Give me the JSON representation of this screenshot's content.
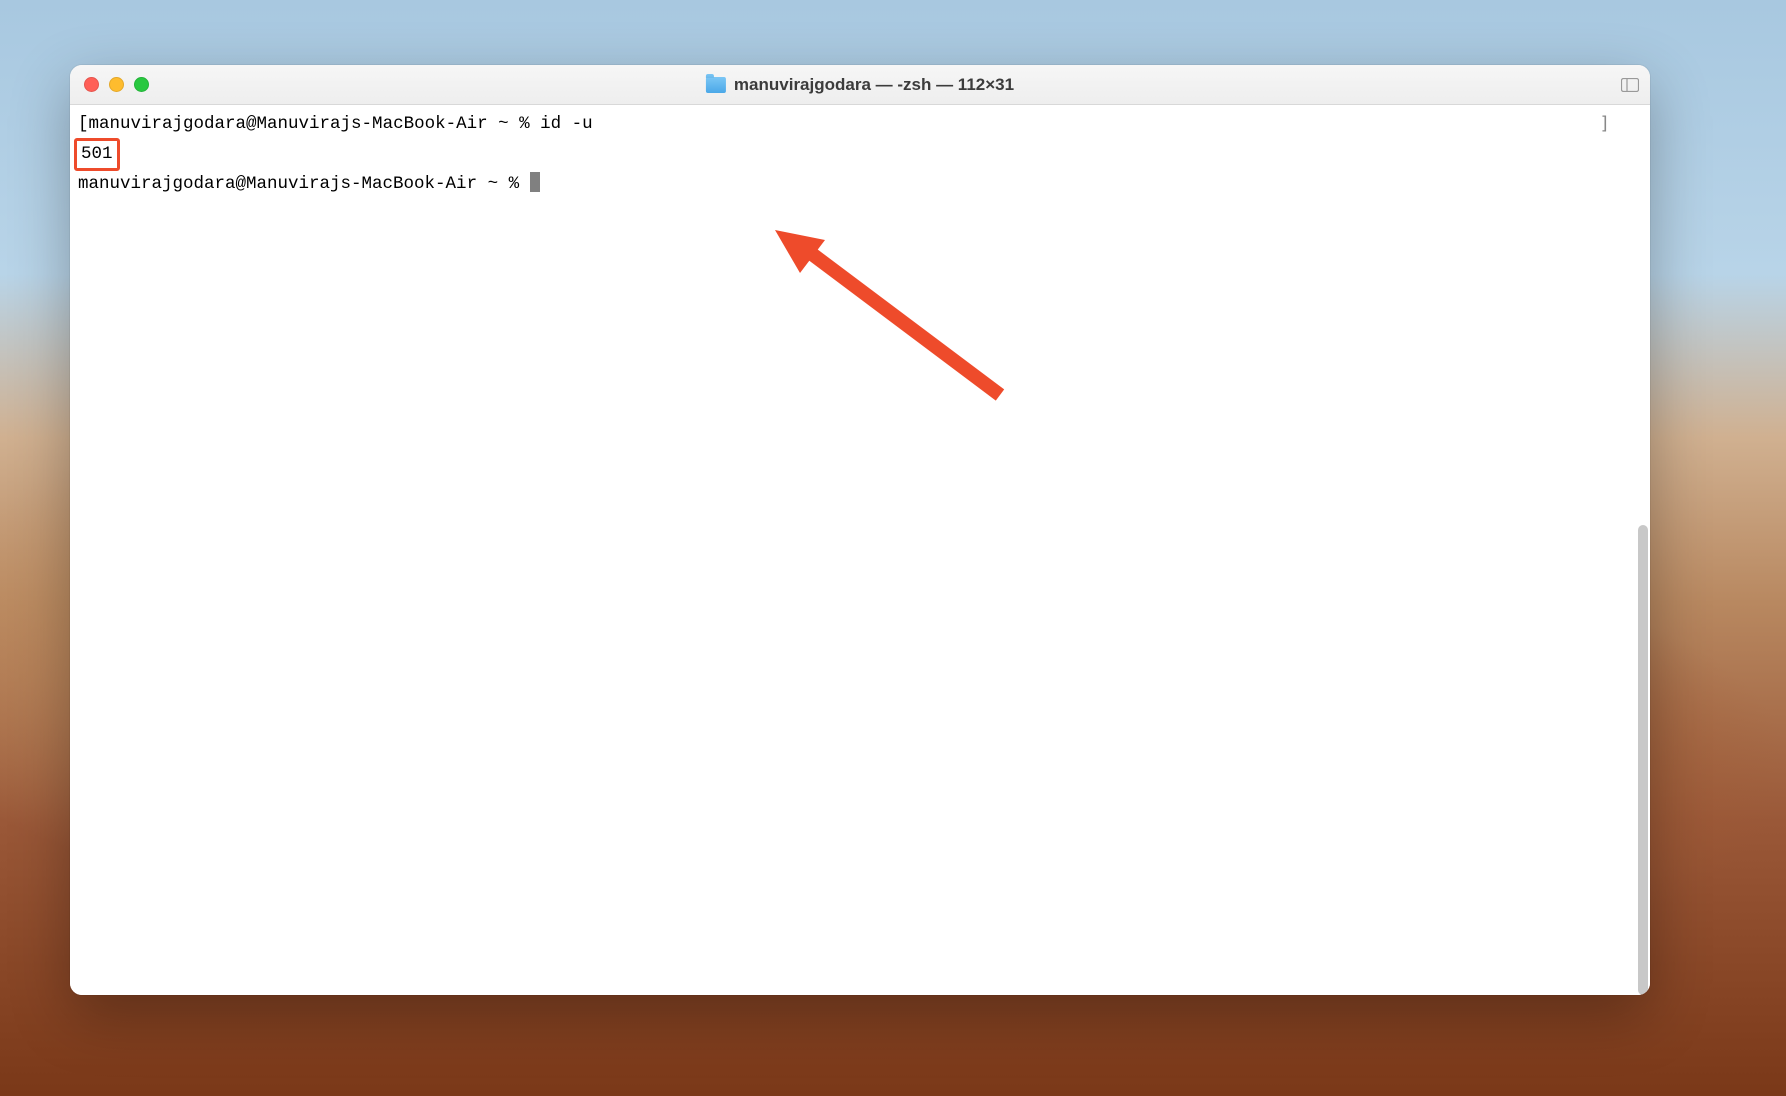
{
  "window": {
    "title": "manuvirajgodara — -zsh — 112×31"
  },
  "terminal": {
    "prompt1_prefix": "[",
    "prompt1_user_host": "manuvirajgodara@Manuvirajs-MacBook-Air",
    "prompt1_path_marker": " ~ % ",
    "command1": "id -u",
    "output1": "501",
    "prompt2_user_host": "manuvirajgodara@Manuvirajs-MacBook-Air",
    "prompt2_path_marker": " ~ % ",
    "bracket_marker": "]"
  },
  "annotation": {
    "arrow_color": "#ee4b2b",
    "highlight_color": "#ee4b2b"
  }
}
